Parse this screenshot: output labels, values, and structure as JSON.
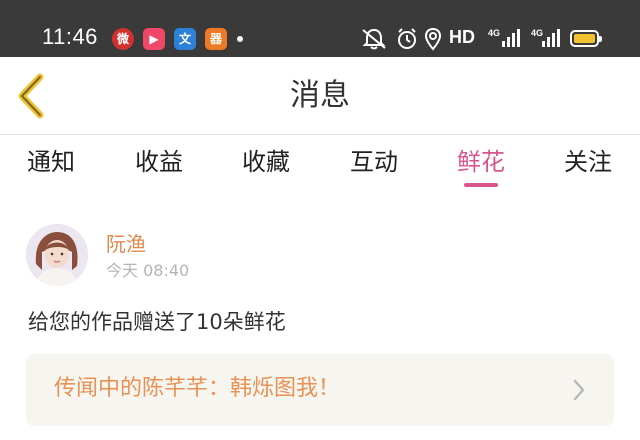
{
  "status_bar": {
    "time": "11:46",
    "app_icons": [
      {
        "name": "weibo-style-icon",
        "glyph": "微"
      },
      {
        "name": "video-play-icon",
        "glyph": "▶"
      },
      {
        "name": "translate-icon",
        "glyph": "文"
      },
      {
        "name": "app-orange-icon",
        "glyph": "器"
      }
    ],
    "hd_label": "HD",
    "signal_1_label": "4G",
    "signal_2_label": "4G",
    "battery_color": "#f1c232"
  },
  "nav": {
    "title": "消息",
    "back_icon_color": "#f1c232"
  },
  "tabs": [
    {
      "label": "通知",
      "active": false
    },
    {
      "label": "收益",
      "active": false
    },
    {
      "label": "收藏",
      "active": false
    },
    {
      "label": "互动",
      "active": false
    },
    {
      "label": "鲜花",
      "active": true
    },
    {
      "label": "关注",
      "active": false
    }
  ],
  "message": {
    "user_name": "阮渔",
    "timestamp": "今天 08:40",
    "text": "给您的作品赠送了10朵鲜花",
    "work_title": "传闻中的陈芊芊：韩烁图我！"
  },
  "colors": {
    "accent_pink": "#d9558f",
    "name_orange": "#e0884a",
    "card_bg": "#f6f5ef"
  }
}
